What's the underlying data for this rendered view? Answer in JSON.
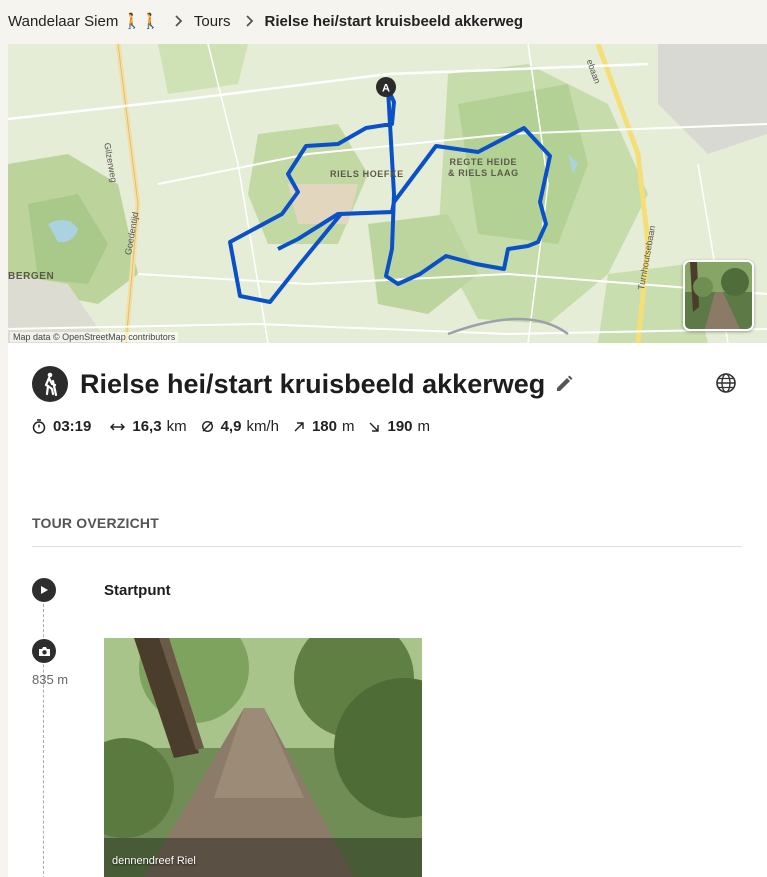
{
  "breadcrumb": {
    "user": "Wandelaar Siem 🚶🚶",
    "section": "Tours",
    "current": "Rielse hei/start kruisbeeld akkerweg"
  },
  "map": {
    "attribution": "Map data © OpenStreetMap contributors",
    "start_marker": "A",
    "labels": {
      "area1": "RIELS HOEFKE",
      "area2_line1": "REGTE HEIDE",
      "area2_line2": "& RIELS LAAG",
      "town": "BERGEN",
      "road1": "Gilzerweg",
      "road2": "Goedentijd",
      "road3": "Turnhoutsebaan",
      "road4": "ebaan"
    },
    "route_color": "#0a50c8"
  },
  "tour": {
    "title": "Rielse hei/start kruisbeeld akkerweg",
    "sport_icon": "hiking-icon"
  },
  "stats": {
    "duration": "03:19",
    "distance_value": "16,3",
    "distance_unit": "km",
    "speed_value": "4,9",
    "speed_unit": "km/h",
    "ascent_value": "180",
    "ascent_unit": "m",
    "descent_value": "190",
    "descent_unit": "m"
  },
  "overview": {
    "title": "TOUR OVERZICHT",
    "start_label": "Startpunt",
    "photo_distance": "835 m",
    "photo_caption": "dennendreef Riel"
  }
}
